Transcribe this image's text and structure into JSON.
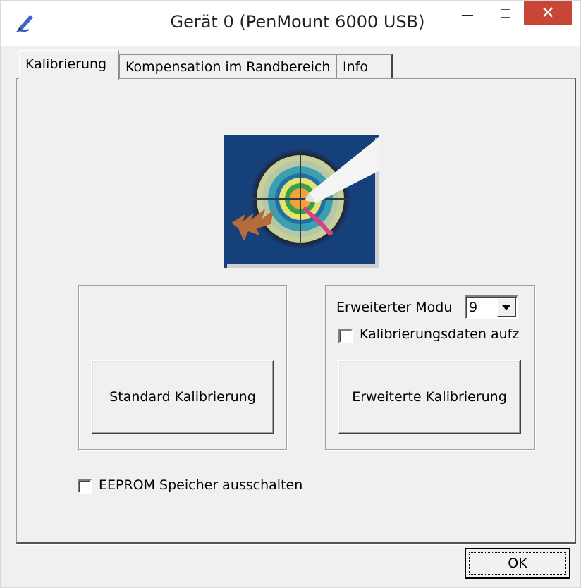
{
  "window": {
    "title": "Gerät 0 (PenMount 6000 USB)",
    "close_glyph": "✕",
    "icons": [
      "pen-icon",
      "minimize-icon",
      "maximize-icon",
      "close-icon"
    ]
  },
  "tabs": [
    {
      "label": "Kalibrierung",
      "active": true
    },
    {
      "label": "Kompensation im Randbereich",
      "active": false
    },
    {
      "label": "Info",
      "active": false
    }
  ],
  "calibration": {
    "standard_button": "Standard Kalibrierung",
    "advanced_mode_label": "Erweiterter Modus",
    "advanced_mode_value": "9",
    "save_data_label": "Kalibrierungsdaten aufzeichnen",
    "save_data_checked": false,
    "advanced_button": "Erweiterte Kalibrierung",
    "eeprom_label": "EEPROM Speicher ausschalten",
    "eeprom_checked": false
  },
  "footer": {
    "ok_label": "OK"
  },
  "colors": {
    "close_button": "#c84636",
    "illustration_bg": "#16407a"
  }
}
